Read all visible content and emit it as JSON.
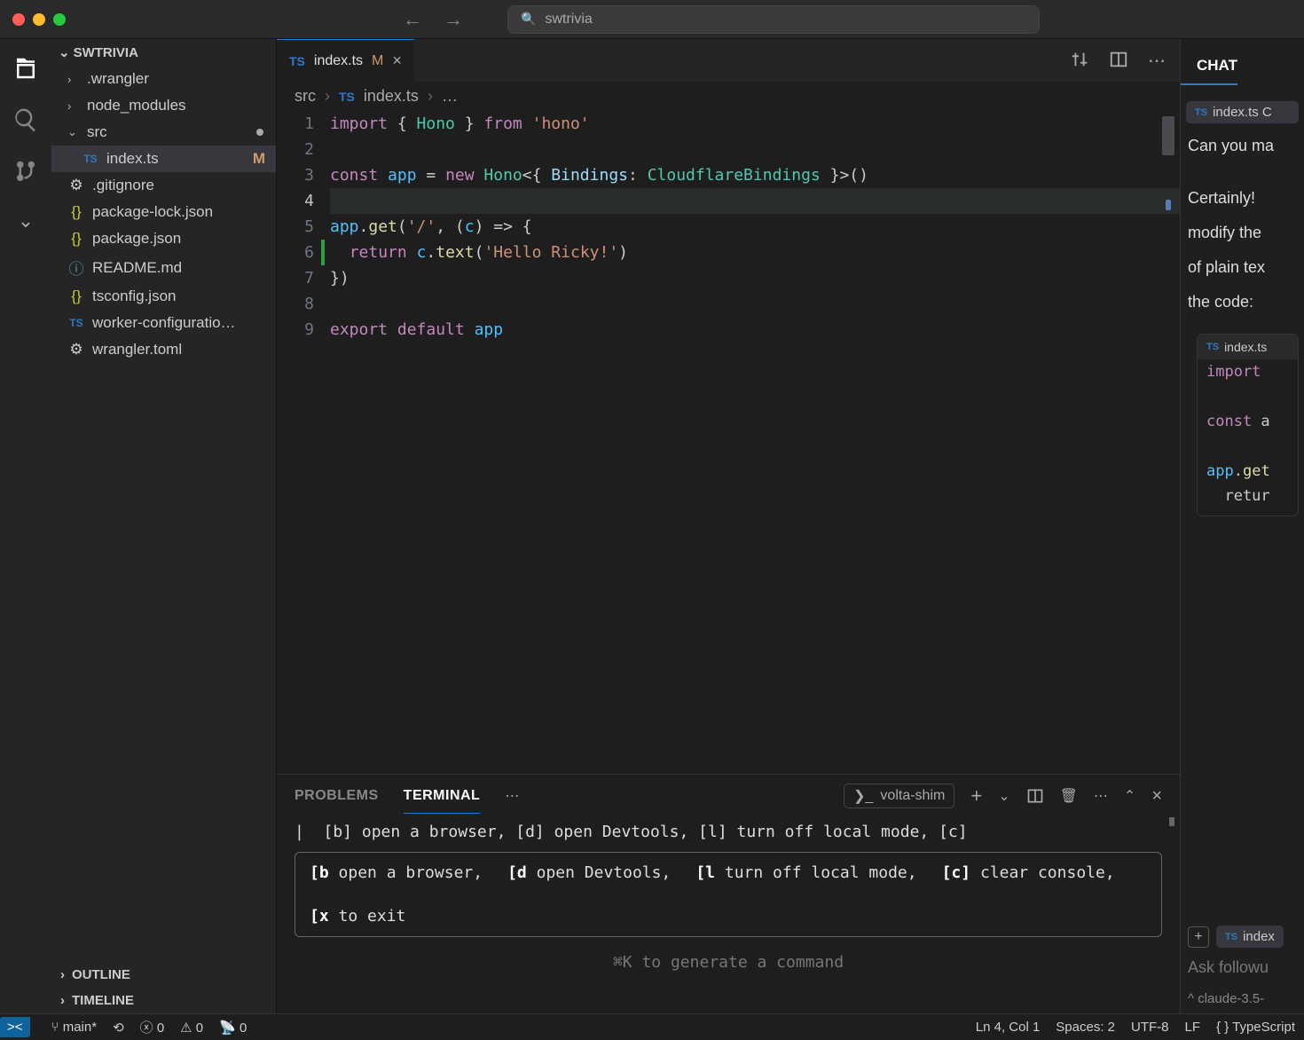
{
  "titlebar": {
    "search_text": "swtrivia"
  },
  "explorer": {
    "header": "SWTRIVIA",
    "tree": [
      {
        "label": ".wrangler",
        "icon": "folder",
        "chev": "›",
        "indent": false
      },
      {
        "label": "node_modules",
        "icon": "folder",
        "chev": "›",
        "indent": false
      },
      {
        "label": "src",
        "icon": "folder-open",
        "chev": "⌄",
        "dot": true,
        "indent": false
      },
      {
        "label": "index.ts",
        "icon": "ts",
        "badge": "M",
        "indent": true,
        "selected": true
      },
      {
        "label": ".gitignore",
        "icon": "gear",
        "indent": false
      },
      {
        "label": "package-lock.json",
        "icon": "json",
        "indent": false
      },
      {
        "label": "package.json",
        "icon": "json",
        "indent": false
      },
      {
        "label": "README.md",
        "icon": "info",
        "indent": false
      },
      {
        "label": "tsconfig.json",
        "icon": "json",
        "indent": false
      },
      {
        "label": "worker-configuratio…",
        "icon": "ts",
        "indent": false
      },
      {
        "label": "wrangler.toml",
        "icon": "gear",
        "indent": false
      }
    ],
    "outline": "OUTLINE",
    "timeline": "TIMELINE"
  },
  "tab": {
    "icon": "TS",
    "name": "index.ts",
    "modified": "M"
  },
  "breadcrumb": {
    "a": "src",
    "b_icon": "TS",
    "b": "index.ts",
    "c": "…"
  },
  "code": {
    "lines": [
      "import { Hono } from 'hono'",
      "",
      "const app = new Hono<{ Bindings: CloudflareBindings }>()",
      "",
      "app.get('/', (c) => {",
      "  return c.text('Hello Ricky!')",
      "})",
      "",
      "export default app"
    ]
  },
  "panel": {
    "tabs": {
      "problems": "PROBLEMS",
      "terminal": "TERMINAL"
    },
    "shim": "volta-shim",
    "line1": "|  [b] open a browser, [d] open Devtools, [l] turn off local mode, [c]",
    "box": [
      {
        "k": "[b",
        "t": " open a browser,"
      },
      {
        "k": "[d",
        "t": " open Devtools,"
      },
      {
        "k": "[l",
        "t": " turn off local mode,"
      },
      {
        "k": "[c]",
        "t": " clear console,"
      },
      {
        "k": "[x",
        "t": " to exit"
      }
    ],
    "gen": "⌘K to generate a command"
  },
  "chat": {
    "title": "CHAT",
    "chip": "index.ts C",
    "user_line": "Can you ma",
    "reply1": "Certainly! ",
    "reply2": "modify the",
    "reply3": "of plain tex",
    "reply4": "the code:",
    "code_hdr": "index.ts",
    "code_lines": [
      "import ",
      "",
      "const a",
      "",
      "app.get",
      "  retur"
    ],
    "ctx_chip": "index",
    "input_placeholder": "Ask followu",
    "model": "^ claude-3.5-"
  },
  "status": {
    "branch": "main*",
    "errors": "0",
    "warnings": "0",
    "ports": "0",
    "cursor": "Ln 4, Col 1",
    "spaces": "Spaces: 2",
    "encoding": "UTF-8",
    "eol": "LF",
    "lang": "TypeScript"
  }
}
